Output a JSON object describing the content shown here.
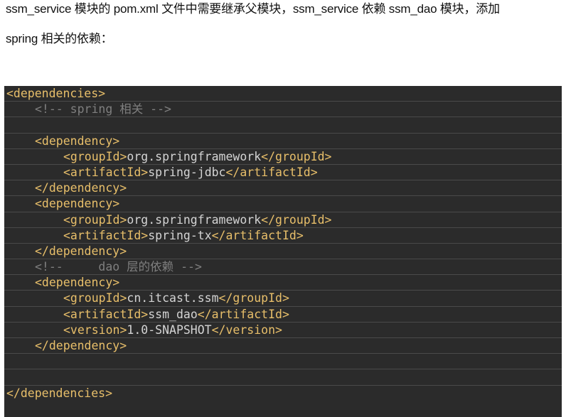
{
  "intro": {
    "line1": "ssm_service 模块的 pom.xml 文件中需要继承父模块，ssm_service 依赖 ssm_dao 模块，添加",
    "line2": "spring 相关的依赖："
  },
  "code": {
    "lines": [
      {
        "kind": "tag",
        "indent": 0,
        "open": "<dependencies>"
      },
      {
        "kind": "comment",
        "indent": 1,
        "text": "<!-- spring 相关 -->"
      },
      {
        "kind": "blank"
      },
      {
        "kind": "tag",
        "indent": 1,
        "open": "<dependency>"
      },
      {
        "kind": "element",
        "indent": 2,
        "open": "<groupId>",
        "value": "org.springframework",
        "close": "</groupId>"
      },
      {
        "kind": "element",
        "indent": 2,
        "open": "<artifactId>",
        "value": "spring-jdbc",
        "close": "</artifactId>"
      },
      {
        "kind": "tag",
        "indent": 1,
        "open": "</dependency>"
      },
      {
        "kind": "tag",
        "indent": 1,
        "open": "<dependency>"
      },
      {
        "kind": "element",
        "indent": 2,
        "open": "<groupId>",
        "value": "org.springframework",
        "close": "</groupId>"
      },
      {
        "kind": "element",
        "indent": 2,
        "open": "<artifactId>",
        "value": "spring-tx",
        "close": "</artifactId>"
      },
      {
        "kind": "tag",
        "indent": 1,
        "open": "</dependency>"
      },
      {
        "kind": "comment",
        "indent": 1,
        "text": "<!--     dao 层的依赖 -->"
      },
      {
        "kind": "tag",
        "indent": 1,
        "open": "<dependency>"
      },
      {
        "kind": "element",
        "indent": 2,
        "open": "<groupId>",
        "value": "cn.itcast.ssm",
        "close": "</groupId>"
      },
      {
        "kind": "element",
        "indent": 2,
        "open": "<artifactId>",
        "value": "ssm_dao",
        "close": "</artifactId>"
      },
      {
        "kind": "element",
        "indent": 2,
        "open": "<version>",
        "value": "1.0-SNAPSHOT",
        "close": "</version>"
      },
      {
        "kind": "tag",
        "indent": 1,
        "open": "</dependency>"
      },
      {
        "kind": "blank"
      },
      {
        "kind": "blank"
      },
      {
        "kind": "tag",
        "indent": 0,
        "open": "</dependencies>"
      }
    ]
  }
}
